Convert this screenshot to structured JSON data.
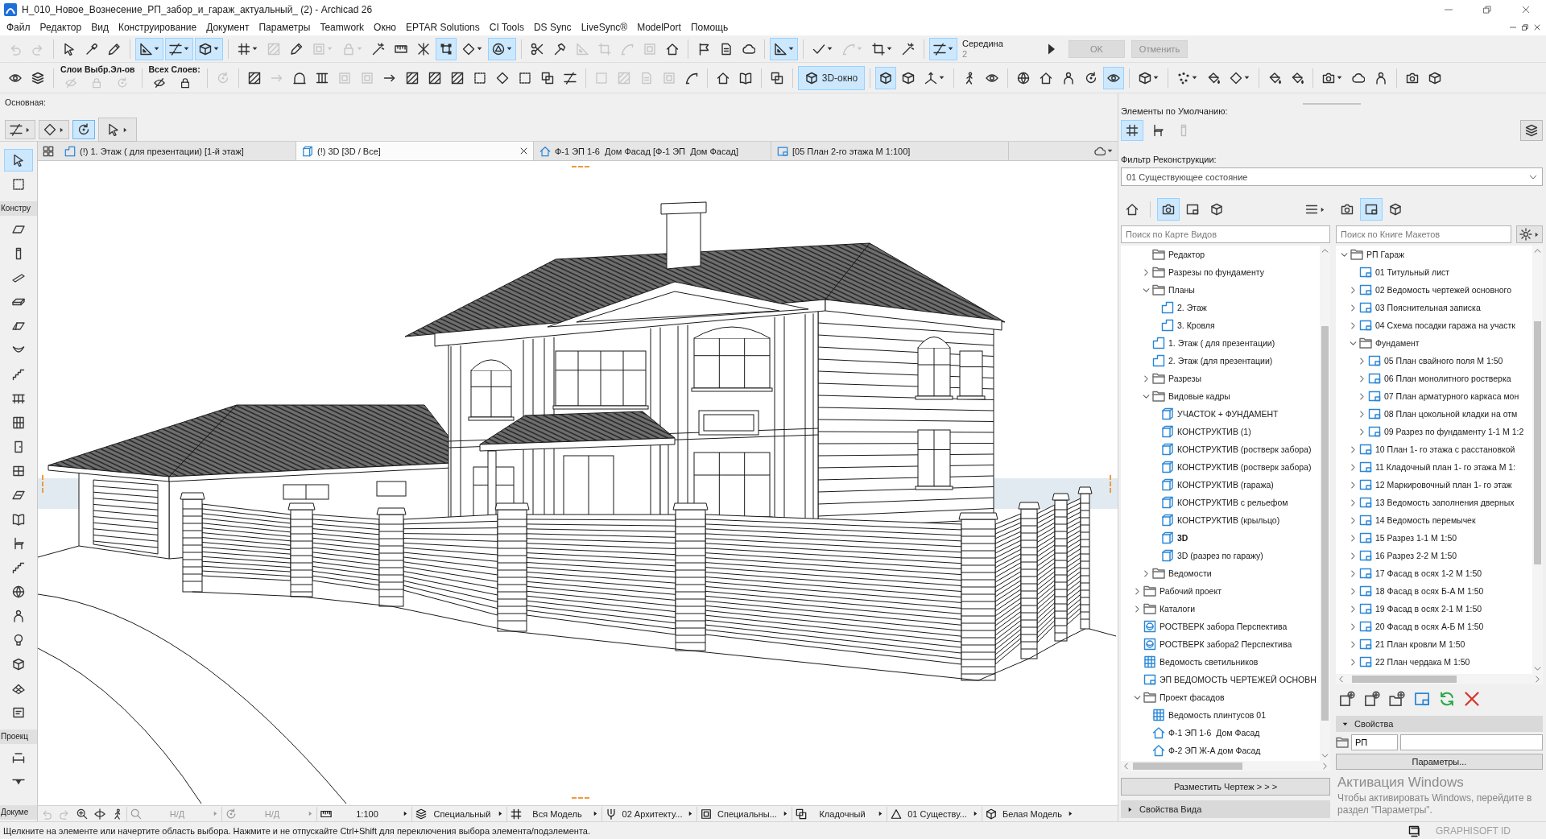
{
  "window": {
    "title": "Н_010_Новое_Вознесение_РП_забор_и_гараж_актуальный_ (2) - Archicad 26"
  },
  "menu": [
    "Файл",
    "Редактор",
    "Вид",
    "Конструирование",
    "Документ",
    "Параметры",
    "Teamwork",
    "Окно",
    "EPTAR Solutions",
    "CI Tools",
    "DS Sync",
    "LiveSync®",
    "ModelPort",
    "Помощь"
  ],
  "toolbar_1": [
    {
      "kind": "button",
      "on": false,
      "disabled": true,
      "dropdown": false
    },
    {
      "kind": "button",
      "on": false,
      "disabled": true,
      "dropdown": false
    },
    {
      "kind": "separator"
    },
    {
      "kind": "button",
      "on": false,
      "disabled": false,
      "dropdown": false
    },
    {
      "kind": "button",
      "on": false,
      "disabled": false,
      "dropdown": false
    },
    {
      "kind": "button",
      "on": false,
      "disabled": false,
      "dropdown": false
    },
    {
      "kind": "separator"
    },
    {
      "kind": "button",
      "on": true,
      "disabled": false,
      "dropdown": true
    },
    {
      "kind": "button",
      "on": true,
      "disabled": false,
      "dropdown": true
    },
    {
      "kind": "button",
      "on": true,
      "disabled": false,
      "dropdown": true
    },
    {
      "kind": "separator"
    },
    {
      "kind": "button",
      "on": false,
      "disabled": false,
      "dropdown": true
    },
    {
      "kind": "button",
      "on": false,
      "disabled": true,
      "dropdown": false
    },
    {
      "kind": "button",
      "on": false,
      "disabled": false,
      "dropdown": false
    },
    {
      "kind": "button",
      "on": false,
      "disabled": true,
      "dropdown": true
    },
    {
      "kind": "button",
      "on": false,
      "disabled": true,
      "dropdown": true
    },
    {
      "kind": "button",
      "on": false,
      "disabled": false,
      "dropdown": false
    },
    {
      "kind": "button",
      "on": false,
      "disabled": false,
      "dropdown": false
    },
    {
      "kind": "button",
      "on": false,
      "disabled": false,
      "dropdown": false
    },
    {
      "kind": "button",
      "on": true,
      "disabled": false,
      "dropdown": false
    },
    {
      "kind": "button",
      "on": false,
      "disabled": false,
      "dropdown": true
    },
    {
      "kind": "button",
      "on": true,
      "disabled": false,
      "dropdown": true
    },
    {
      "kind": "separator"
    },
    {
      "kind": "button",
      "on": false,
      "disabled": false,
      "dropdown": false
    },
    {
      "kind": "button",
      "on": false,
      "disabled": false,
      "dropdown": false
    },
    {
      "kind": "button",
      "on": false,
      "disabled": true,
      "dropdown": false
    },
    {
      "kind": "button",
      "on": false,
      "disabled": true,
      "dropdown": false
    },
    {
      "kind": "button",
      "on": false,
      "disabled": true,
      "dropdown": false
    },
    {
      "kind": "button",
      "on": false,
      "disabled": true,
      "dropdown": false
    },
    {
      "kind": "button",
      "on": false,
      "disabled": false,
      "dropdown": false
    },
    {
      "kind": "separator"
    },
    {
      "kind": "button",
      "on": false,
      "disabled": false,
      "dropdown": false
    },
    {
      "kind": "button",
      "on": false,
      "disabled": false,
      "dropdown": false
    },
    {
      "kind": "button",
      "on": false,
      "disabled": false,
      "dropdown": false
    },
    {
      "kind": "separator"
    },
    {
      "kind": "button",
      "on": true,
      "disabled": false,
      "dropdown": true
    },
    {
      "kind": "separator"
    },
    {
      "kind": "button",
      "on": false,
      "disabled": false,
      "dropdown": true
    },
    {
      "kind": "button",
      "on": false,
      "disabled": true,
      "dropdown": true
    },
    {
      "kind": "button",
      "on": false,
      "disabled": false,
      "dropdown": true
    },
    {
      "kind": "button",
      "on": false,
      "disabled": false,
      "dropdown": false
    },
    {
      "kind": "separator"
    },
    {
      "kind": "button",
      "on": true,
      "disabled": false,
      "dropdown": true
    },
    {
      "kind": "readout",
      "label": "Середина",
      "value": "2"
    },
    {
      "kind": "button",
      "on": false,
      "disabled": false,
      "dropdown": false
    },
    {
      "kind": "textbutton",
      "label": "OK",
      "disabled": true
    },
    {
      "kind": "textbutton",
      "label": "Отменить",
      "disabled": true
    }
  ],
  "toolbar_2": [
    {
      "kind": "button",
      "on": false,
      "disabled": false,
      "dropdown": false
    },
    {
      "kind": "button",
      "on": false,
      "disabled": false,
      "dropdown": false
    },
    {
      "kind": "separator"
    },
    {
      "kind": "group",
      "label": "Слои Выбр.Эл-ов",
      "buttons": [
        {
          "on": false,
          "disabled": true
        },
        {
          "on": false,
          "disabled": true
        },
        {
          "on": false,
          "disabled": true
        }
      ]
    },
    {
      "kind": "separator"
    },
    {
      "kind": "group",
      "label": "Всех Слоев:",
      "buttons": [
        {
          "on": false,
          "disabled": false
        },
        {
          "on": false,
          "disabled": false
        }
      ]
    },
    {
      "kind": "separator"
    },
    {
      "kind": "button",
      "on": false,
      "disabled": true,
      "dropdown": false
    },
    {
      "kind": "separator"
    },
    {
      "kind": "button",
      "on": false,
      "disabled": false,
      "dropdown": false
    },
    {
      "kind": "button",
      "on": false,
      "disabled": true,
      "dropdown": false
    },
    {
      "kind": "button",
      "on": false,
      "disabled": false,
      "dropdown": false
    },
    {
      "kind": "button",
      "on": false,
      "disabled": false,
      "dropdown": false
    },
    {
      "kind": "button",
      "on": false,
      "disabled": true,
      "dropdown": false
    },
    {
      "kind": "button",
      "on": false,
      "disabled": true,
      "dropdown": false
    },
    {
      "kind": "button",
      "on": false,
      "disabled": false,
      "dropdown": false
    },
    {
      "kind": "button",
      "on": false,
      "disabled": false,
      "dropdown": false
    },
    {
      "kind": "button",
      "on": false,
      "disabled": false,
      "dropdown": false
    },
    {
      "kind": "button",
      "on": false,
      "disabled": false,
      "dropdown": false
    },
    {
      "kind": "button",
      "on": false,
      "disabled": false,
      "dropdown": false
    },
    {
      "kind": "button",
      "on": false,
      "disabled": false,
      "dropdown": false
    },
    {
      "kind": "button",
      "on": false,
      "disabled": false,
      "dropdown": false
    },
    {
      "kind": "button",
      "on": false,
      "disabled": false,
      "dropdown": false
    },
    {
      "kind": "button",
      "on": false,
      "disabled": false,
      "dropdown": false
    },
    {
      "kind": "separator"
    },
    {
      "kind": "button",
      "on": false,
      "disabled": true,
      "dropdown": false
    },
    {
      "kind": "button",
      "on": false,
      "disabled": true,
      "dropdown": false
    },
    {
      "kind": "button",
      "on": false,
      "disabled": true,
      "dropdown": false
    },
    {
      "kind": "button",
      "on": false,
      "disabled": true,
      "dropdown": false
    },
    {
      "kind": "button",
      "on": false,
      "disabled": false,
      "dropdown": false
    },
    {
      "kind": "separator"
    },
    {
      "kind": "button",
      "on": false,
      "disabled": false,
      "dropdown": false
    },
    {
      "kind": "button",
      "on": false,
      "disabled": false,
      "dropdown": false
    },
    {
      "kind": "separator"
    },
    {
      "kind": "button",
      "on": false,
      "disabled": false,
      "dropdown": false
    },
    {
      "kind": "separator"
    },
    {
      "kind": "labelbutton",
      "label": "3D-окно",
      "on": true,
      "disabled": false,
      "dropdown": false
    },
    {
      "kind": "separator"
    },
    {
      "kind": "button",
      "on": true,
      "disabled": false,
      "dropdown": false
    },
    {
      "kind": "button",
      "on": false,
      "disabled": false,
      "dropdown": false
    },
    {
      "kind": "button",
      "on": false,
      "disabled": false,
      "dropdown": true
    },
    {
      "kind": "separator"
    },
    {
      "kind": "button",
      "on": false,
      "disabled": false,
      "dropdown": false
    },
    {
      "kind": "button",
      "on": false,
      "disabled": false,
      "dropdown": false
    },
    {
      "kind": "separator"
    },
    {
      "kind": "button",
      "on": false,
      "disabled": false,
      "dropdown": false
    },
    {
      "kind": "button",
      "on": false,
      "disabled": false,
      "dropdown": false
    },
    {
      "kind": "button",
      "on": false,
      "disabled": false,
      "dropdown": false
    },
    {
      "kind": "button",
      "on": false,
      "disabled": false,
      "dropdown": false
    },
    {
      "kind": "button",
      "on": true,
      "disabled": false,
      "dropdown": false
    },
    {
      "kind": "separator"
    },
    {
      "kind": "button",
      "on": false,
      "disabled": false,
      "dropdown": true
    },
    {
      "kind": "separator"
    },
    {
      "kind": "button",
      "on": false,
      "disabled": false,
      "dropdown": true
    },
    {
      "kind": "button",
      "on": false,
      "disabled": false,
      "dropdown": false
    },
    {
      "kind": "button",
      "on": false,
      "disabled": false,
      "dropdown": true
    },
    {
      "kind": "separator"
    },
    {
      "kind": "button",
      "on": false,
      "disabled": false,
      "dropdown": false
    },
    {
      "kind": "button",
      "on": false,
      "disabled": false,
      "dropdown": false
    },
    {
      "kind": "separator"
    },
    {
      "kind": "button",
      "on": false,
      "disabled": false,
      "dropdown": true
    },
    {
      "kind": "button",
      "on": false,
      "disabled": false,
      "dropdown": false
    },
    {
      "kind": "button",
      "on": false,
      "disabled": false,
      "dropdown": false
    },
    {
      "kind": "separator"
    },
    {
      "kind": "button",
      "on": false,
      "disabled": false,
      "dropdown": false
    },
    {
      "kind": "button",
      "on": false,
      "disabled": false,
      "dropdown": false
    }
  ],
  "info_box": {
    "label": "Основная:",
    "buttons": [
      {
        "on": false,
        "dropdown": true
      },
      {
        "on": false,
        "dropdown": true
      },
      {
        "on": true,
        "dropdown": false
      },
      {
        "on": false,
        "dropdown": true
      }
    ]
  },
  "toolbox": {
    "top_tools": [
      {
        "selected": true
      },
      {
        "selected": false
      }
    ],
    "sections": [
      {
        "label": "Констру",
        "tools": [
          {
            "selected": false
          },
          {
            "selected": false
          },
          {
            "selected": false
          },
          {
            "selected": false
          },
          {
            "selected": false
          },
          {
            "selected": false
          },
          {
            "selected": false
          },
          {
            "selected": false
          },
          {
            "selected": false
          },
          {
            "selected": false
          },
          {
            "selected": false
          },
          {
            "selected": false
          },
          {
            "selected": false
          },
          {
            "selected": false
          },
          {
            "selected": false
          },
          {
            "selected": false
          },
          {
            "selected": false
          },
          {
            "selected": false
          },
          {
            "selected": false
          },
          {
            "selected": false
          },
          {
            "selected": false
          }
        ]
      },
      {
        "label": "Проекц",
        "tools": [
          {
            "selected": false
          },
          {
            "selected": false
          }
        ]
      },
      {
        "label": "Докуме"
      }
    ]
  },
  "tabs": [
    {
      "kind": "plan",
      "label": "(!) 1. Этаж ( для презентации) [1-й этаж]",
      "selected": false
    },
    {
      "kind": "view3d",
      "label": "(!) 3D [3D / Все]",
      "selected": true
    },
    {
      "kind": "elevation",
      "label": "Ф-1 ЭП 1-6  Дом Фасад [Ф-1 ЭП  Дом Фасад]",
      "selected": false
    },
    {
      "kind": "layout",
      "label": "[05 План 2-го этажа М 1:100]",
      "selected": false
    }
  ],
  "quick_options_bar": {
    "view_buttons": [
      {
        "disabled": true
      },
      {
        "disabled": true
      },
      {
        "disabled": false
      },
      {
        "disabled": false
      },
      {
        "disabled": false
      }
    ],
    "options": [
      {
        "label": "Н/Д",
        "disabled": true
      },
      {
        "label": "Н/Д",
        "disabled": true
      },
      {
        "label": "1:100",
        "disabled": false
      },
      {
        "label": "Специальный",
        "disabled": false
      },
      {
        "label": "Вся Модель",
        "disabled": false
      },
      {
        "label": "02 Архитекту...",
        "disabled": false
      },
      {
        "label": "Специальны...",
        "disabled": false
      },
      {
        "label": "Кладочный",
        "disabled": false
      },
      {
        "label": "01 Существу...",
        "disabled": false
      },
      {
        "label": "Белая Модель",
        "disabled": false
      }
    ]
  },
  "side_panel": {
    "defaults": {
      "label": "Элементы по Умолчанию:",
      "buttons": [
        {
          "on": true,
          "disabled": false
        },
        {
          "on": false,
          "disabled": false
        },
        {
          "on": false,
          "disabled": true
        }
      ]
    },
    "renovation_filter": {
      "label": "Фильтр Реконструкции:",
      "value": "01 Существующее состояние"
    },
    "view_map": {
      "mode_buttons": [
        {
          "selected": false
        },
        {
          "selected": true
        },
        {
          "selected": false
        },
        {
          "selected": false
        }
      ],
      "search": {
        "placeholder": "Поиск по Карте Видов"
      },
      "scrolled_branch": [
        {
          "kind": "folder",
          "label": "Редактор",
          "expandable": false,
          "expanded": false
        },
        {
          "kind": "folder",
          "label": "Разрезы по фундаменту",
          "expandable": true,
          "expanded": false
        },
        {
          "kind": "folder",
          "label": "Планы",
          "expandable": true,
          "expanded": true,
          "children": [
            {
              "kind": "story",
              "label": "2. Этаж",
              "expandable": false,
              "expanded": false
            },
            {
              "kind": "story",
              "label": "3. Кровля",
              "expandable": false,
              "expanded": false
            }
          ]
        },
        {
          "kind": "story",
          "label": "1. Этаж ( для презентации)",
          "expandable": false,
          "expanded": false
        },
        {
          "kind": "story",
          "label": "2. Этаж (для презентации)",
          "expandable": false,
          "expanded": false
        },
        {
          "kind": "folder",
          "label": "Разрезы",
          "expandable": true,
          "expanded": false
        },
        {
          "kind": "folder",
          "label": "Видовые кадры",
          "expandable": true,
          "expanded": true,
          "children": [
            {
              "kind": "view3d",
              "label": "УЧАСТОК + ФУНДАМЕНТ",
              "expandable": false,
              "expanded": false,
              "open": false
            },
            {
              "kind": "view3d",
              "label": "КОНСТРУКТИВ (1)",
              "expandable": false,
              "expanded": false,
              "open": false
            },
            {
              "kind": "view3d",
              "label": "КОНСТРУКТИВ (ростверк забора)",
              "expandable": false,
              "expanded": false,
              "open": false
            },
            {
              "kind": "view3d",
              "label": "КОНСТРУКТИВ (ростверк забора)",
              "expandable": false,
              "expanded": false,
              "open": false
            },
            {
              "kind": "view3d",
              "label": "КОНСТРУКТИВ (гаража)",
              "expandable": false,
              "expanded": false,
              "open": false
            },
            {
              "kind": "view3d",
              "label": "КОНСТРУКТИВ с рельефом",
              "expandable": false,
              "expanded": false,
              "open": false
            },
            {
              "kind": "view3d",
              "label": "КОНСТРУКТИВ (крыльцо)",
              "expandable": false,
              "expanded": false,
              "open": false
            },
            {
              "kind": "view3d",
              "label": "3D",
              "expandable": false,
              "expanded": false,
              "open": true
            },
            {
              "kind": "view3d",
              "label": "3D (разрез по гаражу)",
              "expandable": false,
              "expanded": false,
              "open": false
            }
          ]
        },
        {
          "kind": "folder",
          "label": "Ведомости",
          "expandable": true,
          "expanded": false
        }
      ],
      "items": [
        {
          "kind": "folder",
          "label": "Рабочий проект",
          "expandable": true,
          "expanded": false
        },
        {
          "kind": "folder",
          "label": "Каталоги",
          "expandable": true,
          "expanded": false
        },
        {
          "kind": "perspective",
          "label": "РОСТВЕРК забора Перспектива",
          "expandable": false,
          "expanded": false
        },
        {
          "kind": "perspective",
          "label": "РОСТВЕРК забора2 Перспектива",
          "expandable": false,
          "expanded": false
        },
        {
          "kind": "schedule",
          "label": "Ведомость светильников",
          "expandable": false,
          "expanded": false
        },
        {
          "kind": "drawing",
          "label": "ЭП ВЕДОМОСТЬ ЧЕРТЕЖЕЙ ОСНОВН",
          "expandable": false,
          "expanded": false
        },
        {
          "kind": "folder",
          "label": "Проект фасадов",
          "expandable": true,
          "expanded": true,
          "children": [
            {
              "kind": "schedule",
              "label": "Ведомость плинтусов 01",
              "expandable": false,
              "expanded": false
            },
            {
              "kind": "elevation",
              "label": "Ф-1 ЭП 1-6  Дом Фасад",
              "expandable": false,
              "expanded": false
            },
            {
              "kind": "elevation",
              "label": "Ф-2 ЭП Ж-А дом Фасад",
              "expandable": false,
              "expanded": false
            }
          ]
        }
      ],
      "place_button": "Разместить Чертеж > > >",
      "view_properties": {
        "label": "Свойства Вида",
        "expanded": false
      }
    },
    "layout_book": {
      "mode_buttons": [
        {
          "selected": false
        },
        {
          "selected": true
        },
        {
          "selected": false
        }
      ],
      "search": {
        "placeholder": "Поиск по Книге Макетов"
      },
      "items": [
        {
          "kind": "folder",
          "label": "РП Гараж",
          "expandable": true,
          "expanded": true,
          "children": [
            {
              "kind": "layout",
              "label": "01 Титульный лист",
              "expandable": false,
              "expanded": false
            },
            {
              "kind": "layout",
              "label": "02 Ведомость чертежей основного",
              "expandable": true,
              "expanded": false
            },
            {
              "kind": "layout",
              "label": "03 Пояснительная записка",
              "expandable": true,
              "expanded": false
            },
            {
              "kind": "layout",
              "label": "04 Схема посадки гаража на участк",
              "expandable": true,
              "expanded": false
            },
            {
              "kind": "folder",
              "label": "Фундамент",
              "expandable": true,
              "expanded": true,
              "children": [
                {
                  "kind": "layout",
                  "label": "05 План свайного поля М 1:50",
                  "expandable": true,
                  "expanded": false
                },
                {
                  "kind": "layout",
                  "label": "06 План монолитного ростверка",
                  "expandable": true,
                  "expanded": false
                },
                {
                  "kind": "layout",
                  "label": "07 План арматурного каркаса мон",
                  "expandable": true,
                  "expanded": false
                },
                {
                  "kind": "layout",
                  "label": "08 План цокольной кладки на отм",
                  "expandable": true,
                  "expanded": false
                },
                {
                  "kind": "layout",
                  "label": "09 Разрез по фундаменту 1-1 М 1:2",
                  "expandable": true,
                  "expanded": false
                }
              ]
            },
            {
              "kind": "layout",
              "label": "10 План 1- го этажа с расстановкой",
              "expandable": true,
              "expanded": false
            },
            {
              "kind": "layout",
              "label": "11 Кладочный план 1- го этажа М 1:",
              "expandable": true,
              "expanded": false
            },
            {
              "kind": "layout",
              "label": "12 Маркировочный план 1- го этаж",
              "expandable": true,
              "expanded": false
            },
            {
              "kind": "layout",
              "label": "13 Ведомость заполнения дверных",
              "expandable": true,
              "expanded": false
            },
            {
              "kind": "layout",
              "label": "14 Ведомость перемычек",
              "expandable": true,
              "expanded": false
            },
            {
              "kind": "layout",
              "label": "15 Разрез 1-1 М 1:50",
              "expandable": true,
              "expanded": false
            },
            {
              "kind": "layout",
              "label": "16 Разрез 2-2 М 1:50",
              "expandable": true,
              "expanded": false
            },
            {
              "kind": "layout",
              "label": "17 Фасад в осях 1-2 М 1:50",
              "expandable": true,
              "expanded": false
            },
            {
              "kind": "layout",
              "label": "18 Фасад в осях Б-А М 1:50",
              "expandable": true,
              "expanded": false
            },
            {
              "kind": "layout",
              "label": "19 Фасад в осях 2-1 М 1:50",
              "expandable": true,
              "expanded": false
            },
            {
              "kind": "layout",
              "label": "20 Фасад в осях А-Б М 1:50",
              "expandable": true,
              "expanded": false
            },
            {
              "kind": "layout",
              "label": "21 План кровли М 1:50",
              "expandable": true,
              "expanded": false
            },
            {
              "kind": "layout",
              "label": "22 План чердака М 1:50",
              "expandable": true,
              "expanded": false
            }
          ]
        }
      ],
      "properties": {
        "label": "Свойства",
        "expanded": true,
        "value": "РП"
      },
      "params_button": "Параметры..."
    }
  },
  "status_bar": {
    "message": "Щелкните на элементе или начертите область выбора. Нажмите и не отпускайте Ctrl+Shift для переключения выбора элемента/подэлемента.",
    "account": "GRAPHISOFT ID"
  },
  "windows_notice": {
    "title": "Активация Windows",
    "text": "Чтобы активировать Windows, перейдите в раздел \"Параметры\"."
  }
}
